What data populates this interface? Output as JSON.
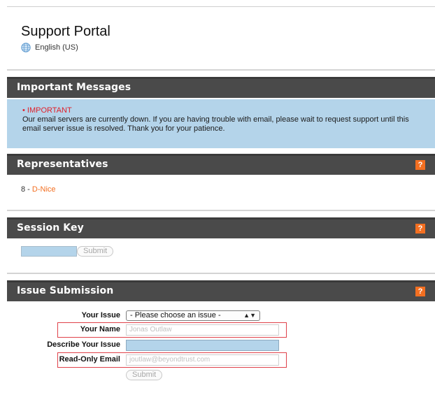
{
  "header": {
    "title": "Support Portal",
    "language": "English (US)"
  },
  "sections": {
    "messages": {
      "title": "Important Messages"
    },
    "representatives": {
      "title": "Representatives",
      "help": "?"
    },
    "session_key": {
      "title": "Session Key",
      "help": "?"
    },
    "issue": {
      "title": "Issue Submission",
      "help": "?"
    }
  },
  "messages": {
    "label": "• IMPORTANT",
    "body": "Our email servers are currently down. If you are having trouble with email, please wait to request support until this email server issue is resolved. Thank you for your patience."
  },
  "representative": {
    "prefix": "8 - ",
    "name": "D-Nice"
  },
  "session_key": {
    "submit_label": "Submit"
  },
  "form": {
    "issue_label": "Your Issue",
    "issue_selected": "- Please choose an issue -",
    "name_label": "Your Name",
    "name_value": "Jonas Outlaw",
    "describe_label": "Describe Your Issue",
    "email_label": "Read-Only Email",
    "email_value": "joutlaw@beyondtrust.com",
    "submit_label": "Submit"
  },
  "colors": {
    "bar": "#4a4a4a",
    "accent": "#f36f21",
    "message_bg": "#b4d4ea",
    "highlight": "#e0424a"
  }
}
